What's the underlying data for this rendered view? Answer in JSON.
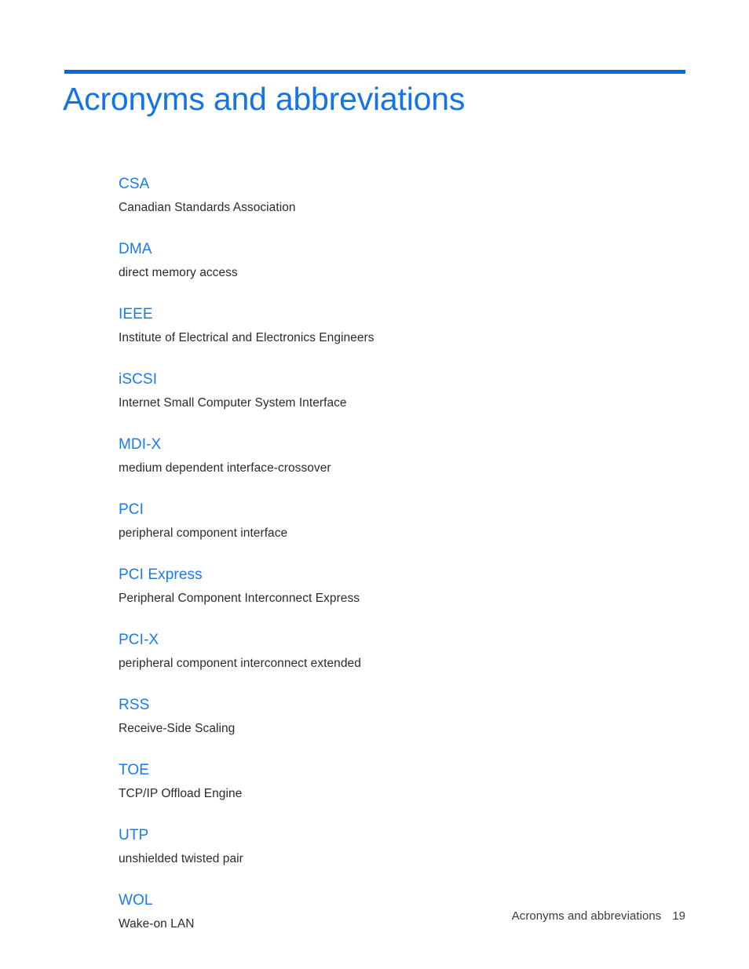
{
  "document": {
    "title": "Acronyms and abbreviations",
    "accent_color": "#0a66e0",
    "title_color": "#1473e6",
    "term_color": "#1a7aee",
    "body_color": "#2b2b2b",
    "background_color": "#ffffff"
  },
  "glossary": [
    {
      "term": "CSA",
      "definition": "Canadian Standards Association"
    },
    {
      "term": "DMA",
      "definition": "direct memory access"
    },
    {
      "term": "IEEE",
      "definition": "Institute of Electrical and Electronics Engineers"
    },
    {
      "term": "iSCSI",
      "definition": "Internet Small Computer System Interface"
    },
    {
      "term": "MDI-X",
      "definition": "medium dependent interface-crossover"
    },
    {
      "term": "PCI",
      "definition": "peripheral component interface"
    },
    {
      "term": "PCI Express",
      "definition": "Peripheral Component Interconnect Express"
    },
    {
      "term": "PCI-X",
      "definition": "peripheral component interconnect extended"
    },
    {
      "term": "RSS",
      "definition": "Receive-Side Scaling"
    },
    {
      "term": "TOE",
      "definition": "TCP/IP Offload Engine"
    },
    {
      "term": "UTP",
      "definition": "unshielded twisted pair"
    },
    {
      "term": "WOL",
      "definition": "Wake-on LAN"
    }
  ],
  "footer": {
    "label": "Acronyms and abbreviations",
    "page_number": "19"
  }
}
